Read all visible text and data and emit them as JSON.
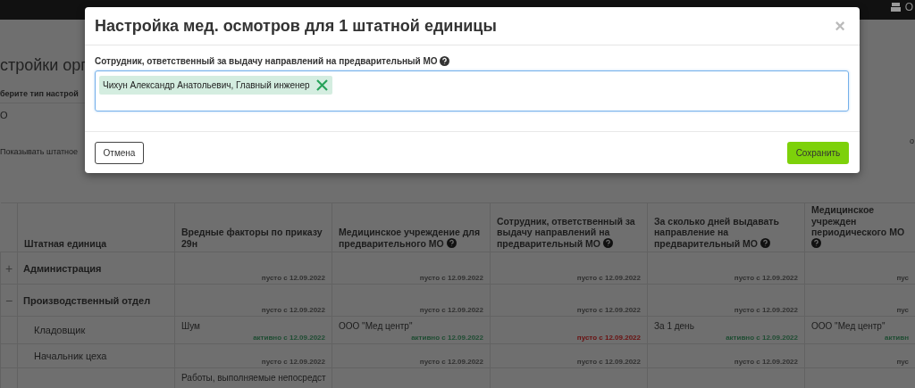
{
  "top_bar": {
    "user_text": "О"
  },
  "page": {
    "title": "стройки орг",
    "type_label": "берите тип настрой",
    "type_value": "О",
    "show_label": "Показывать штатное",
    "right_text": "о"
  },
  "table": {
    "name_column": {
      "label": "Штатная единица"
    },
    "columns": [
      {
        "label": "Вредные факторы по приказу 29н",
        "help": false
      },
      {
        "label": "Медицинское учреждение для предварительного МО",
        "help": true
      },
      {
        "label": "Сотрудник, ответственный за выдачу направлений на предварительный МО",
        "help": true
      },
      {
        "label": "За сколько дней выдавать направление на предварительный МО",
        "help": true
      },
      {
        "label": "Медицинское учрежден периодического МО",
        "help": true
      }
    ],
    "rows": [
      {
        "toggle": "+",
        "name": "Администрация",
        "kind": "group",
        "cells": [
          {
            "status": "пусто с 12.09.2022",
            "color": "#303030"
          },
          {
            "status": "пусто с 12.09.2022",
            "color": "#303030"
          },
          {
            "status": "пусто с 12.09.2022",
            "color": "#303030"
          },
          {
            "status": "пусто с 12.09.2022",
            "color": "#303030"
          },
          {
            "status": "пус",
            "color": "#303030"
          }
        ]
      },
      {
        "toggle": "−",
        "name": "Производственный отдел",
        "kind": "group",
        "cells": [
          {
            "status": "пусто с 12.09.2022",
            "color": "#303030"
          },
          {
            "status": "пусто с 12.09.2022",
            "color": "#303030"
          },
          {
            "status": "пусто с 12.09.2022",
            "color": "#303030"
          },
          {
            "status": "пусто с 12.09.2022",
            "color": "#303030"
          },
          {
            "status": "пус",
            "color": "#303030"
          }
        ]
      },
      {
        "name": "Кладовщик",
        "kind": "unit",
        "cells": [
          {
            "value": "Шум",
            "status": "активно с 12.09.2022",
            "color": "#1f4d33"
          },
          {
            "value": "ООО \"Мед центр\"",
            "status": "активно с 12.09.2022",
            "color": "#1f4d33"
          },
          {
            "status": "пусто с 12.09.2022",
            "color": "#6a1010"
          },
          {
            "value": "За 1 день",
            "status": "активно с 12.09.2022",
            "color": "#1f4d33"
          },
          {
            "value": "ООО \"Мед центр\"",
            "status": "активн",
            "color": "#1f4d33"
          }
        ]
      },
      {
        "name": "Начальник цеха",
        "kind": "unit",
        "cells": [
          {
            "status": "пусто с 12.09.2022",
            "color": "#303030"
          },
          {
            "status": "пусто с 12.09.2022",
            "color": "#303030"
          },
          {
            "status": "пусто с 12.09.2022",
            "color": "#303030"
          },
          {
            "status": "пусто с 12.09.2022",
            "color": "#303030"
          },
          {
            "status": "пус",
            "color": "#303030"
          }
        ]
      },
      {
        "kind": "unit",
        "cells": [
          {
            "value": "Работы, выполняемые непосредст"
          }
        ]
      }
    ]
  },
  "modal": {
    "title": "Настройка мед. осмотров для 1 штатной единицы",
    "close": "×",
    "field_label": "Сотрудник, ответственный за выдачу направлений на предварительный МО",
    "tags": [
      {
        "label": "Чихун Александр Анатольевич, Главный инженер"
      }
    ],
    "cancel": "Отмена",
    "save": "Сохранить"
  }
}
